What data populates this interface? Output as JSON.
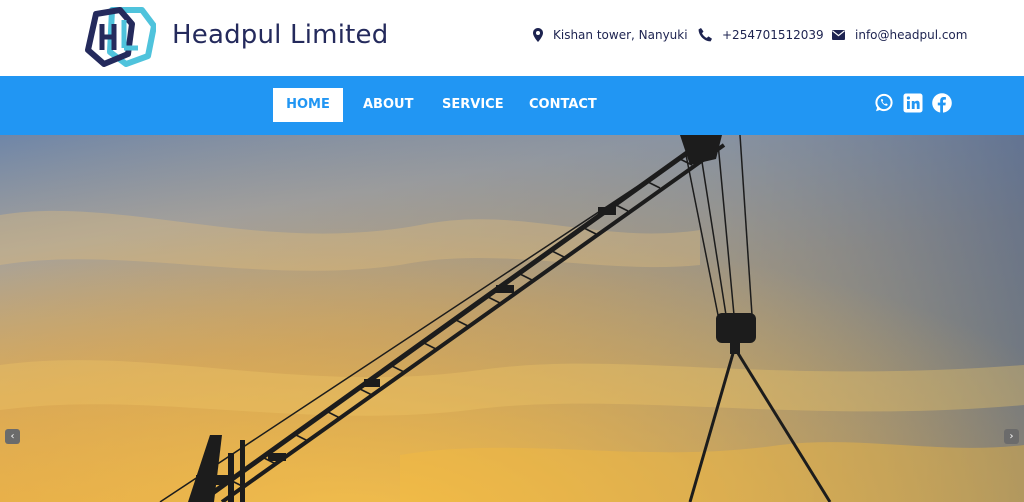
{
  "brand": {
    "name": "Headpul Limited",
    "logo_text": "HL",
    "colors": {
      "dark": "#242a5c",
      "accent": "#4fc3dc"
    }
  },
  "contact": {
    "address": "Kishan tower, Nanyuki",
    "phone": "+254701512039",
    "email": "info@headpul.com",
    "icons": [
      "map-pin-icon",
      "phone-icon",
      "envelope-icon"
    ]
  },
  "nav": {
    "bg_color": "#2196f3",
    "items": [
      {
        "label": "HOME",
        "active": true
      },
      {
        "label": "ABOUT",
        "active": false
      },
      {
        "label": "SERVICE",
        "active": false
      },
      {
        "label": "CONTACT",
        "active": false
      }
    ],
    "social": [
      "whatsapp-icon",
      "linkedin-icon",
      "facebook-icon"
    ]
  },
  "slider": {
    "prev_glyph": "‹",
    "next_glyph": "›",
    "image": "construction-crane-at-sunset"
  }
}
